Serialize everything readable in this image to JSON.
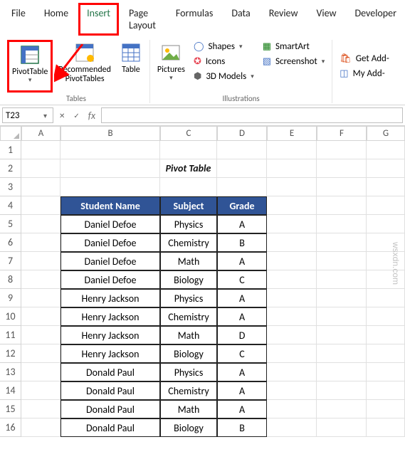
{
  "tabs": [
    "File",
    "Home",
    "Insert",
    "Page Layout",
    "Formulas",
    "Data",
    "Review",
    "View",
    "Developer"
  ],
  "active_tab": "Insert",
  "ribbon": {
    "pivot_table": "PivotTable",
    "recommended": "Recommended\nPivotTables",
    "table": "Table",
    "pictures": "Pictures",
    "shapes": "Shapes",
    "icons": "Icons",
    "models": "3D Models",
    "smartart": "SmartArt",
    "screenshot": "Screenshot",
    "get_addins": "Get Add-",
    "my_addins": "My Add-",
    "group_tables": "Tables",
    "group_illustrations": "Illustrations"
  },
  "namebox": "T23",
  "columns": [
    "A",
    "B",
    "C",
    "D",
    "E",
    "F",
    "G"
  ],
  "title": "Pivot Table",
  "headers": {
    "student": "Student Name",
    "subject": "Subject",
    "grade": "Grade"
  },
  "rows": [
    {
      "n": "1"
    },
    {
      "n": "2",
      "title": true
    },
    {
      "n": "3"
    },
    {
      "n": "4",
      "header": true
    },
    {
      "n": "5",
      "d": [
        "Daniel Defoe",
        "Physics",
        "A"
      ]
    },
    {
      "n": "6",
      "d": [
        "Daniel Defoe",
        "Chemistry",
        "B"
      ]
    },
    {
      "n": "7",
      "d": [
        "Daniel Defoe",
        "Math",
        "A"
      ]
    },
    {
      "n": "8",
      "d": [
        "Daniel Defoe",
        "Biology",
        "C"
      ]
    },
    {
      "n": "9",
      "d": [
        "Henry Jackson",
        "Physics",
        "A"
      ]
    },
    {
      "n": "10",
      "d": [
        "Henry Jackson",
        "Chemistry",
        "A"
      ]
    },
    {
      "n": "11",
      "d": [
        "Henry Jackson",
        "Math",
        "D"
      ]
    },
    {
      "n": "12",
      "d": [
        "Henry Jackson",
        "Biology",
        "C"
      ]
    },
    {
      "n": "13",
      "d": [
        "Donald Paul",
        "Physics",
        "A"
      ]
    },
    {
      "n": "14",
      "d": [
        "Donald Paul",
        "Chemistry",
        "A"
      ]
    },
    {
      "n": "15",
      "d": [
        "Donald Paul",
        "Math",
        "A"
      ]
    },
    {
      "n": "16",
      "d": [
        "Donald Paul",
        "Biology",
        "B"
      ]
    }
  ],
  "chart_data": {
    "type": "table",
    "title": "Pivot Table",
    "columns": [
      "Student Name",
      "Subject",
      "Grade"
    ],
    "rows": [
      [
        "Daniel Defoe",
        "Physics",
        "A"
      ],
      [
        "Daniel Defoe",
        "Chemistry",
        "B"
      ],
      [
        "Daniel Defoe",
        "Math",
        "A"
      ],
      [
        "Daniel Defoe",
        "Biology",
        "C"
      ],
      [
        "Henry Jackson",
        "Physics",
        "A"
      ],
      [
        "Henry Jackson",
        "Chemistry",
        "A"
      ],
      [
        "Henry Jackson",
        "Math",
        "D"
      ],
      [
        "Henry Jackson",
        "Biology",
        "C"
      ],
      [
        "Donald Paul",
        "Physics",
        "A"
      ],
      [
        "Donald Paul",
        "Chemistry",
        "A"
      ],
      [
        "Donald Paul",
        "Math",
        "A"
      ],
      [
        "Donald Paul",
        "Biology",
        "B"
      ]
    ]
  },
  "watermark": "wsxdn.com"
}
